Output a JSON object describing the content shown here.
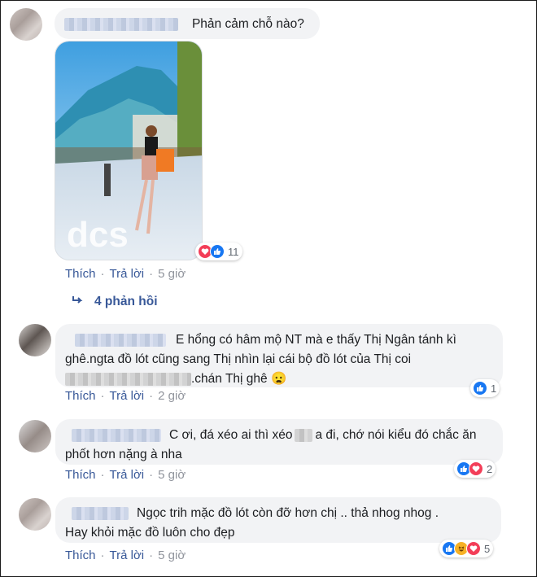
{
  "thread": {
    "comment1": {
      "text": "Phản cảm chỗ nào?",
      "reaction_count": "11",
      "actions": {
        "like": "Thích",
        "reply": "Trả lời",
        "time": "5 giờ"
      }
    },
    "view_replies": "4 phản hồi",
    "comment2": {
      "line1": "E hổng có hâm mộ NT mà e thấy Thị Ngân tánh kì",
      "line2": "ghê.ngta đồ lót cũng sang Thị nhìn lại cái bộ đồ lót của Thị coi",
      "line3": ".chán Thị ghê 😦",
      "reaction_count": "1",
      "actions": {
        "like": "Thích",
        "reply": "Trả lời",
        "time": "2 giờ"
      }
    },
    "comment3": {
      "line1a": "C ơi, đá xéo ai thì xéo",
      "line1b": "a đi, chớ nói kiểu đó chắc ăn",
      "line2": "phốt hơn nặng à nha",
      "reaction_count": "2",
      "actions": {
        "like": "Thích",
        "reply": "Trả lời",
        "time": "5 giờ"
      }
    },
    "comment4": {
      "line1": "Ngọc trih mặc đồ lót còn đỡ hơn chị .. thả nhog nhog .",
      "line2": "Hay khỏi mặc đồ luôn cho đẹp",
      "reaction_count": "5",
      "actions": {
        "like": "Thích",
        "reply": "Trả lời",
        "time": "5 giờ"
      }
    }
  },
  "colors": {
    "link": "#385898",
    "bubble": "#f2f3f5",
    "like": "#1877f2",
    "love": "#f33e58",
    "haha": "#f7b125"
  }
}
